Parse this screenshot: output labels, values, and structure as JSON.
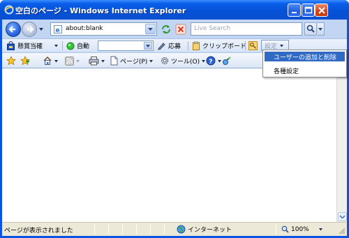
{
  "window": {
    "title": "空白のページ - Windows Internet Explorer"
  },
  "address": {
    "url": "about:blank"
  },
  "search": {
    "placeholder": "Live Search"
  },
  "custom_toolbar": {
    "brand_label": "懸賞当確",
    "auto_label": "自動",
    "combo_value": "",
    "apply_label": "応募",
    "clipboard_label": "クリップボード",
    "settings_label": "設定"
  },
  "command_bar": {
    "page_label": "ページ(P)",
    "tools_label": "ツール(O)"
  },
  "settings_menu": {
    "items": [
      {
        "label": "ユーザーの追加と削除",
        "selected": true
      },
      {
        "label": "各種設定",
        "selected": false
      }
    ]
  },
  "statusbar": {
    "status_text": "ページが表示されました",
    "zone_label": "インターネット",
    "zoom_label": "100%"
  },
  "colors": {
    "titlebar": "#0552d8",
    "chrome": "#c2d6f3",
    "menu_highlight": "#316ac5"
  }
}
